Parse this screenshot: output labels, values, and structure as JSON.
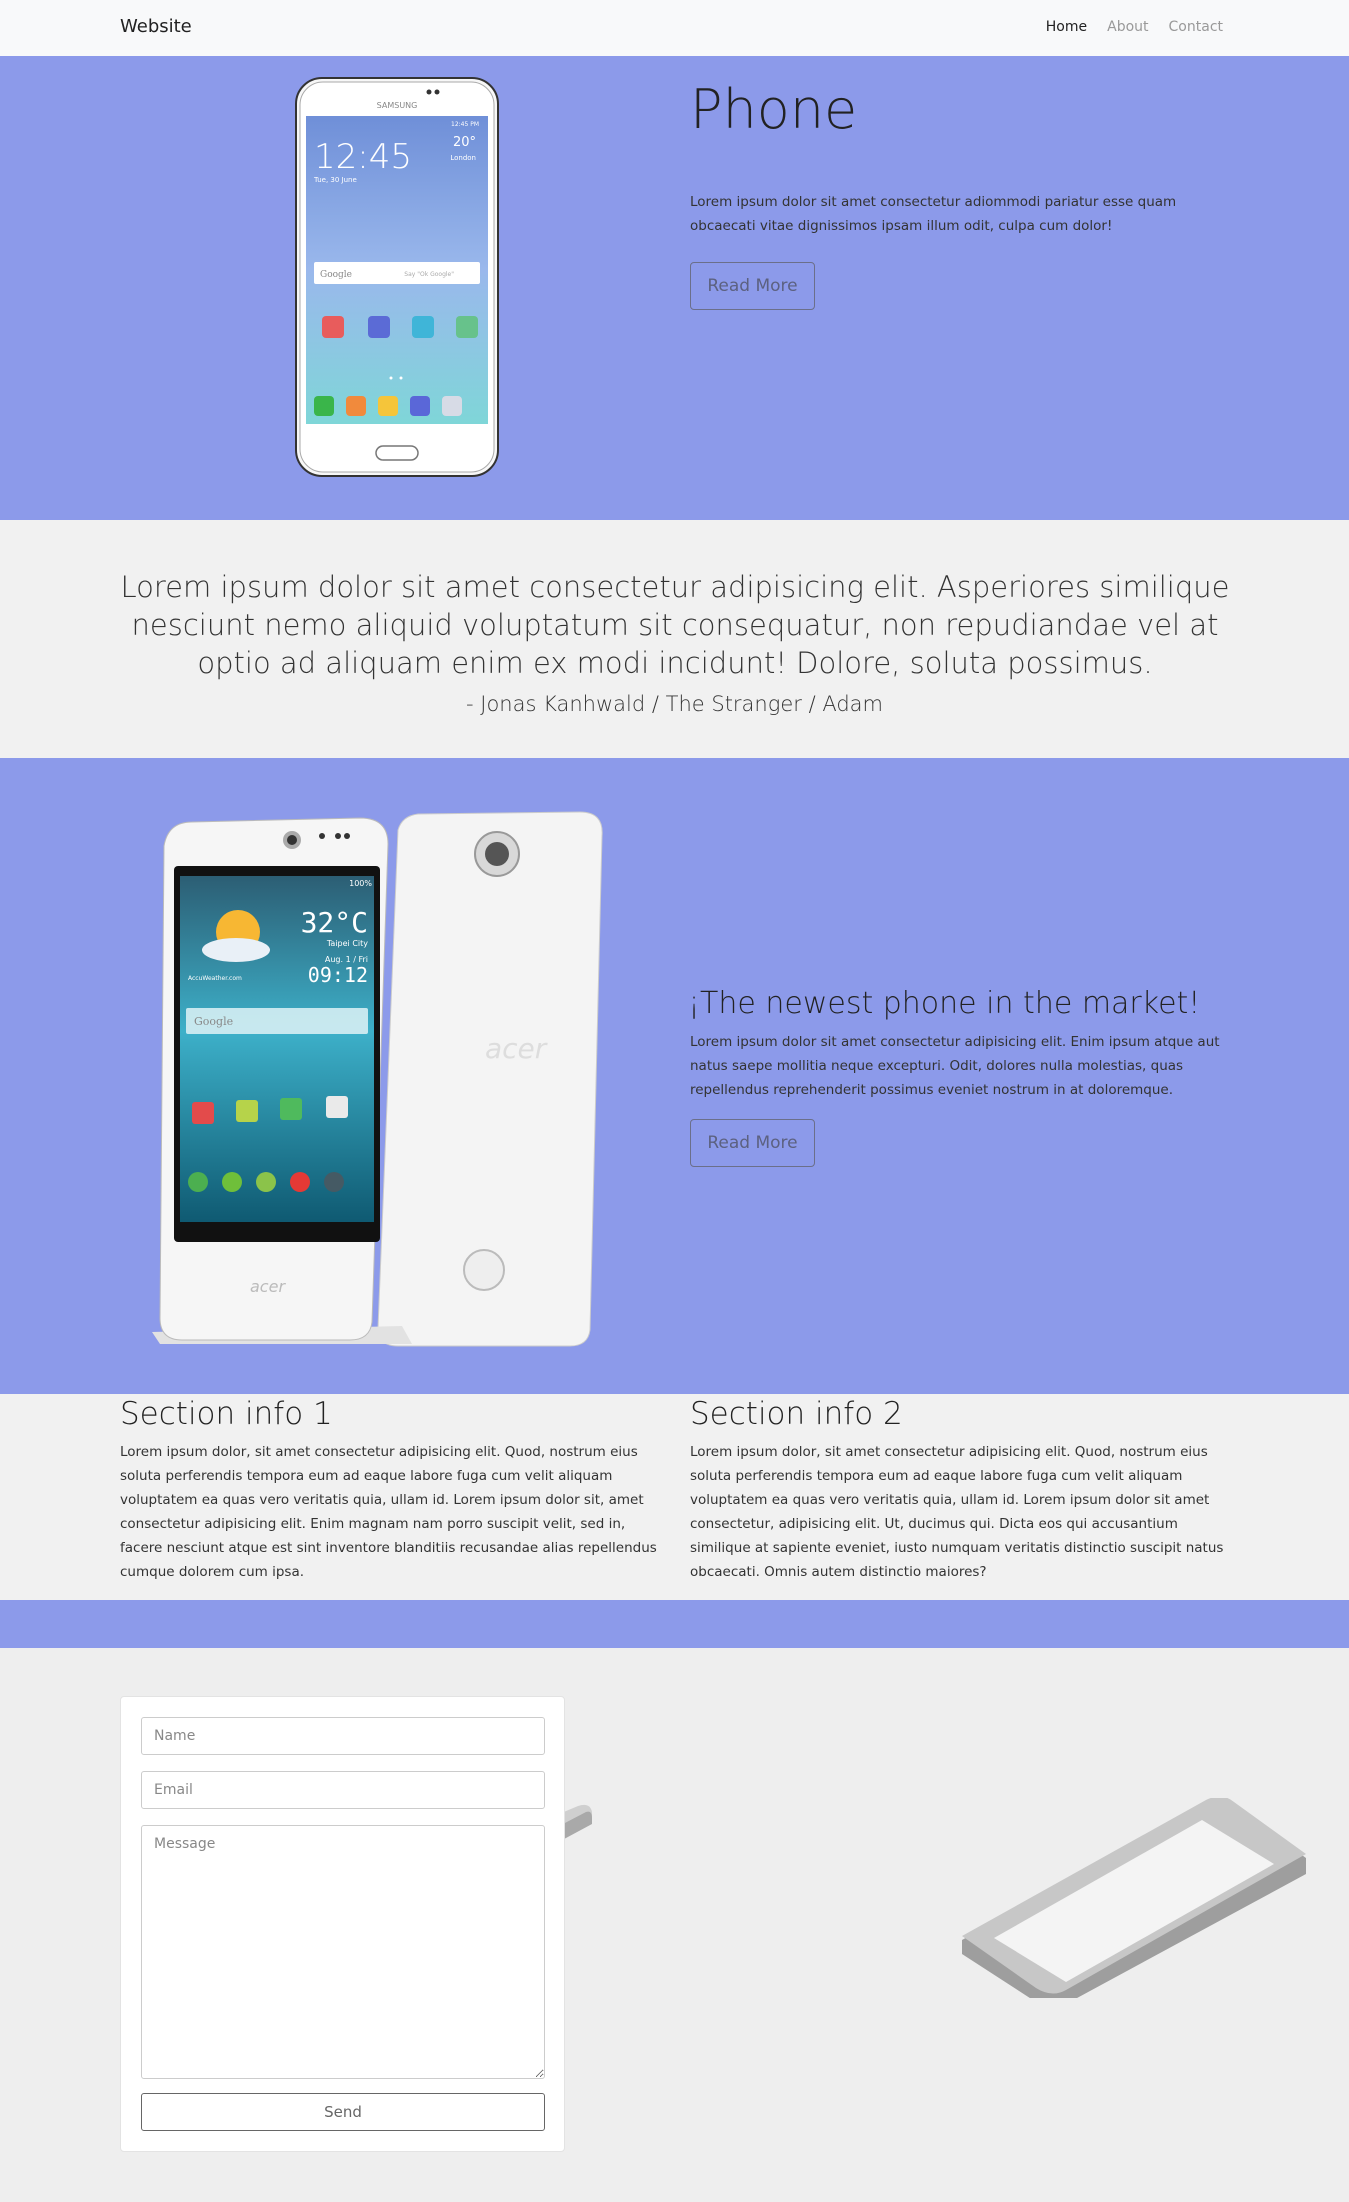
{
  "navbar": {
    "brand": "Website",
    "links": [
      {
        "label": "Home",
        "active": true
      },
      {
        "label": "About",
        "active": false
      },
      {
        "label": "Contact",
        "active": false
      }
    ]
  },
  "hero": {
    "title": "Phone",
    "text": "Lorem ipsum dolor sit amet consectetur adiommodi pariatur esse quam obcaecati vitae dignissimos ipsam illum odit, culpa cum dolor!",
    "button_label": "Read More",
    "phone_screen": {
      "brand": "SAMSUNG",
      "time": "12:45",
      "date": "Tue, 30 June",
      "temperature": "20°",
      "location": "London",
      "status_time": "12:45 PM",
      "search_placeholder": "Google",
      "search_hint": "Say \"Ok Google\"",
      "apps_row1": [
        "Pocket",
        "Camera",
        "Play Store",
        "Google"
      ],
      "apps_row2": [
        "Phone",
        "Contacts",
        "Messages",
        "Internet",
        "Apps"
      ]
    }
  },
  "quote": {
    "text": "Lorem ipsum dolor sit amet consectetur adipisicing elit. Asperiores similique nesciunt nemo aliquid voluptatum sit consequatur, non repudiandae vel at optio ad aliquam enim ex modi incidunt! Dolore, soluta possimus.",
    "author": "- Jonas Kanhwald / The Stranger / Adam"
  },
  "feature": {
    "title": "¡The newest phone in the market!",
    "text": "Lorem ipsum dolor sit amet consectetur adipisicing elit. Enim ipsum atque aut natus saepe mollitia neque excepturi. Odit, dolores nulla molestias, quas repellendus reprehenderit possimus eveniet nostrum in at doloremque.",
    "button_label": "Read More",
    "phone_screen": {
      "battery": "100%",
      "temperature": "32°C",
      "city": "Taipei City",
      "date": "Aug. 1 / Fri",
      "time": "09:12",
      "weather_site": "AccuWeather.com",
      "search_placeholder": "Google",
      "apps": [
        "Google",
        "Gallery",
        "Acer Portal",
        "Play Store"
      ],
      "brand": "acer"
    }
  },
  "info": {
    "sections": [
      {
        "title": "Section info 1",
        "text": "Lorem ipsum dolor, sit amet consectetur adipisicing elit. Quod, nostrum eius soluta perferendis tempora eum ad eaque labore fuga cum velit aliquam voluptatem ea quas vero veritatis quia, ullam id. Lorem ipsum dolor sit, amet consectetur adipisicing elit. Enim magnam nam porro suscipit velit, sed in, facere nesciunt atque est sint inventore blanditiis recusandae alias repellendus cumque dolorem cum ipsa."
      },
      {
        "title": "Section info 2",
        "text": "Lorem ipsum dolor, sit amet consectetur adipisicing elit. Quod, nostrum eius soluta perferendis tempora eum ad eaque labore fuga cum velit aliquam voluptatem ea quas vero veritatis quia, ullam id. Lorem ipsum dolor sit amet consectetur, adipisicing elit. Ut, ducimus qui. Dicta eos qui accusantium similique at sapiente eveniet, iusto numquam veritatis distinctio suscipit natus obcaecati. Omnis autem distinctio maiores?"
      }
    ]
  },
  "contact": {
    "name_placeholder": "Name",
    "email_placeholder": "Email",
    "message_placeholder": "Message",
    "send_label": "Send"
  },
  "colors": {
    "accent": "#8c9aea",
    "page_bg": "#f1f1f1",
    "navbar_bg": "#f8f9fa"
  }
}
